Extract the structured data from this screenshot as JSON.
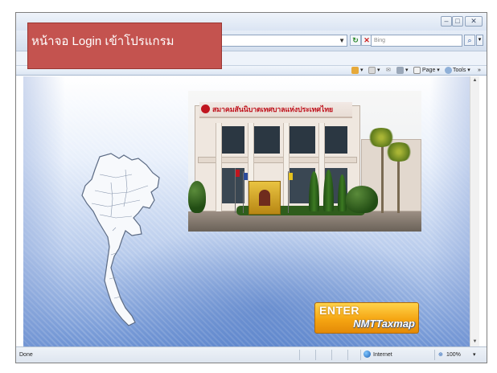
{
  "caption": {
    "text": "หน้าจอ Login เข้าโปรแกรม"
  },
  "browser": {
    "search_placeholder": "Bing",
    "window_controls": [
      "minimize",
      "maximize",
      "close"
    ],
    "command_bar": {
      "page_label": "Page ▾",
      "tools_label": "Tools ▾",
      "more": "»"
    },
    "status": {
      "left": "Done",
      "zone": "Internet",
      "zoom": "100%"
    }
  },
  "page": {
    "building_banner": "สมาคมสันนิบาตเทศบาลแห่งประเทศไทย",
    "enter_button": {
      "label": "ENTER",
      "sub_label": "NMTTaxmap"
    }
  },
  "colors": {
    "caption_bg": "#c4534f",
    "enter_button": "#f5a512",
    "page_gradient_bottom": "#6f94d4"
  },
  "icons": [
    "home-icon",
    "feeds-icon",
    "mail-icon",
    "print-icon",
    "page-icon",
    "tools-icon",
    "search-icon",
    "refresh-icon",
    "stop-icon",
    "globe-icon",
    "zoom-icon"
  ]
}
